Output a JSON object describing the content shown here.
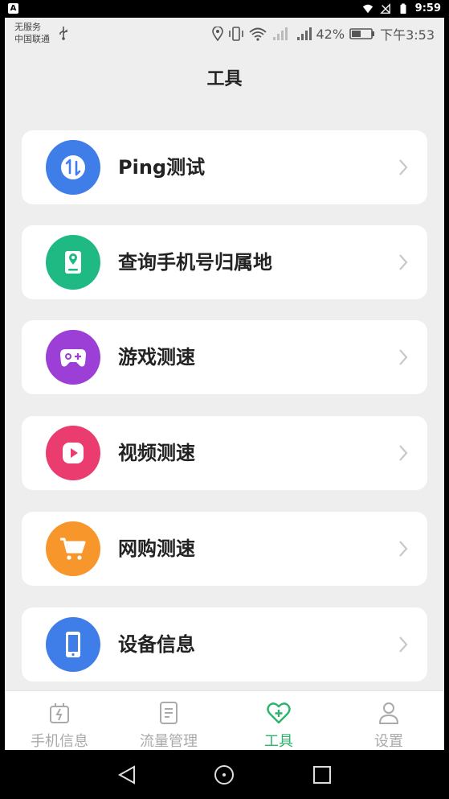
{
  "system_bar": {
    "a_badge": "A",
    "clock": "9:59"
  },
  "status": {
    "carrier_line1": "无服务",
    "carrier_line2": "中国联通",
    "battery_percent": "42%",
    "time": "下午3:53"
  },
  "page_title": "工具",
  "tools": [
    {
      "label": "Ping测试",
      "icon": "ping-icon",
      "color": "#3f7de8"
    },
    {
      "label": "查询手机号归属地",
      "icon": "phone-location-icon",
      "color": "#1fba84"
    },
    {
      "label": "游戏测速",
      "icon": "gamepad-icon",
      "color": "#9b3fd6"
    },
    {
      "label": "视频测速",
      "icon": "play-icon",
      "color": "#ea3c6e"
    },
    {
      "label": "网购测速",
      "icon": "cart-icon",
      "color": "#f7962a"
    },
    {
      "label": "设备信息",
      "icon": "smartphone-icon",
      "color": "#3f7de8"
    }
  ],
  "tabbar": {
    "items": [
      {
        "label": "手机信息",
        "icon": "phone-charge-icon",
        "active": false
      },
      {
        "label": "流量管理",
        "icon": "document-icon",
        "active": false
      },
      {
        "label": "工具",
        "icon": "heart-plus-icon",
        "active": true
      },
      {
        "label": "设置",
        "icon": "person-icon",
        "active": false
      }
    ],
    "active_color": "#2cb36c",
    "inactive_color": "#aaaaaa"
  }
}
